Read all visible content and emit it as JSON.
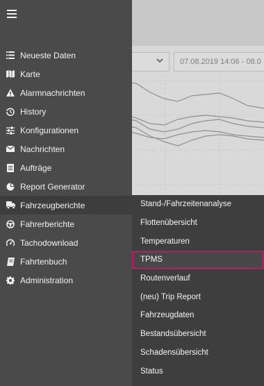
{
  "topbar": {
    "menu_icon": "hamburger-icon"
  },
  "filter": {
    "select_partial": "r",
    "date_range": "07.08.2019 14:06 - 08.0"
  },
  "sidebar": {
    "items": [
      {
        "label": "Neueste Daten",
        "icon": "list-icon"
      },
      {
        "label": "Karte",
        "icon": "map-icon"
      },
      {
        "label": "Alarmnachrichten",
        "icon": "warning-icon"
      },
      {
        "label": "History",
        "icon": "history-icon"
      },
      {
        "label": "Konfigurationen",
        "icon": "sliders-icon"
      },
      {
        "label": "Nachrichten",
        "icon": "envelope-icon"
      },
      {
        "label": "Aufträge",
        "icon": "document-icon"
      },
      {
        "label": "Report Generator",
        "icon": "pie-chart-icon"
      },
      {
        "label": "Fahrzeugberichte",
        "icon": "truck-icon"
      },
      {
        "label": "Fahrerberichte",
        "icon": "steering-wheel-icon"
      },
      {
        "label": "Tachodownload",
        "icon": "tachometer-icon"
      },
      {
        "label": "Fahrtenbuch",
        "icon": "book-icon"
      },
      {
        "label": "Administration",
        "icon": "gear-icon"
      }
    ]
  },
  "submenu": {
    "items": [
      {
        "label": "Stand-/Fahrzeitenanalyse"
      },
      {
        "label": "Flottenübersicht"
      },
      {
        "label": "Temperaturen"
      },
      {
        "label": "TPMS"
      },
      {
        "label": "Routenverlauf"
      },
      {
        "label": "(neu) Trip Report"
      },
      {
        "label": "Fahrzeugdaten"
      },
      {
        "label": "Bestandsübersicht"
      },
      {
        "label": "Schadensübersicht"
      },
      {
        "label": "Status"
      }
    ]
  },
  "colors": {
    "sidebar_bg": "#4a4a4a",
    "submenu_bg": "#3e3e3e",
    "highlight_border": "#a3245a"
  }
}
